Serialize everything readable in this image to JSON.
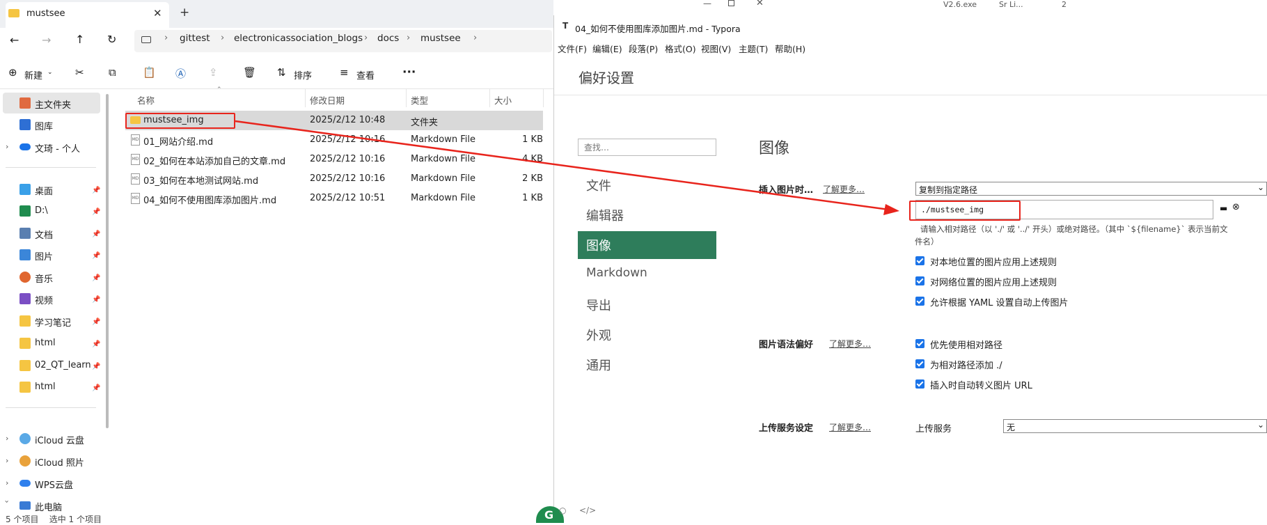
{
  "explorer": {
    "tab_title": "mustsee",
    "breadcrumbs": [
      "gittest",
      "electronicassociation_blogs",
      "docs",
      "mustsee"
    ],
    "toolbar": {
      "new": "新建",
      "sort": "排序",
      "view": "查看"
    },
    "columns": {
      "name": "名称",
      "date": "修改日期",
      "type": "类型",
      "size": "大小"
    },
    "files": [
      {
        "name": "mustsee_img",
        "date": "2025/2/12 10:48",
        "type": "文件夹",
        "size": ""
      },
      {
        "name": "01_网站介绍.md",
        "date": "2025/2/12 10:16",
        "type": "Markdown File",
        "size": "1 KB"
      },
      {
        "name": "02_如何在本站添加自己的文章.md",
        "date": "2025/2/12 10:16",
        "type": "Markdown File",
        "size": "4 KB"
      },
      {
        "name": "03_如何在本地测试网站.md",
        "date": "2025/2/12 10:16",
        "type": "Markdown File",
        "size": "2 KB"
      },
      {
        "name": "04_如何不使用图库添加图片.md",
        "date": "2025/2/12 10:51",
        "type": "Markdown File",
        "size": "1 KB"
      }
    ],
    "sidebar": {
      "home": "主文件夹",
      "gallery": "图库",
      "cloud": "文琦 - 个人",
      "quick": [
        "桌面",
        "D:\\",
        "文档",
        "图片",
        "音乐",
        "视频",
        "学习笔记",
        "html",
        "02_QT_learn",
        "html"
      ],
      "drives": [
        "iCloud 云盘",
        "iCloud 照片",
        "WPS云盘",
        "此电脑"
      ]
    },
    "status": "5 个项目    选中 1 个项目"
  },
  "typora": {
    "title": "04_如何不使用图库添加图片.md - Typora",
    "menu": [
      "文件(F)",
      "编辑(E)",
      "段落(P)",
      "格式(O)",
      "视图(V)",
      "主题(T)",
      "帮助(H)"
    ],
    "pref_title": "偏好设置",
    "search_placeholder": "查找…",
    "categories": [
      "文件",
      "编辑器",
      "图像",
      "Markdown",
      "导出",
      "外观",
      "通用"
    ],
    "section_title": "图像",
    "insert_label": "插入图片时…",
    "learn_more": "了解更多…",
    "insert_option": "复制到指定路径",
    "path_value": "./mustsee_img",
    "path_hint": "请输入相对路径（以 './' 或 '../' 开头）或绝对路径。（其中 `${filename}` 表示当前文",
    "path_hint2": "件名）",
    "insert_checks": [
      "对本地位置的图片应用上述规则",
      "对网络位置的图片应用上述规则",
      "允许根据 YAML 设置自动上传图片"
    ],
    "syntax_label": "图片语法偏好",
    "syntax_checks": [
      "优先使用相对路径",
      "为相对路径添加 ./",
      "插入时自动转义图片 URL"
    ],
    "upload_label": "上传服务设定",
    "upload_service_label": "上传服务",
    "upload_service_value": "无"
  },
  "background_text": {
    "a": "V2.6.exe",
    "b": "Sr Li...",
    "c": "2"
  },
  "colors": {
    "accent": "#2e7d5b",
    "highlight": "#e8241c",
    "check": "#1a73e8"
  }
}
